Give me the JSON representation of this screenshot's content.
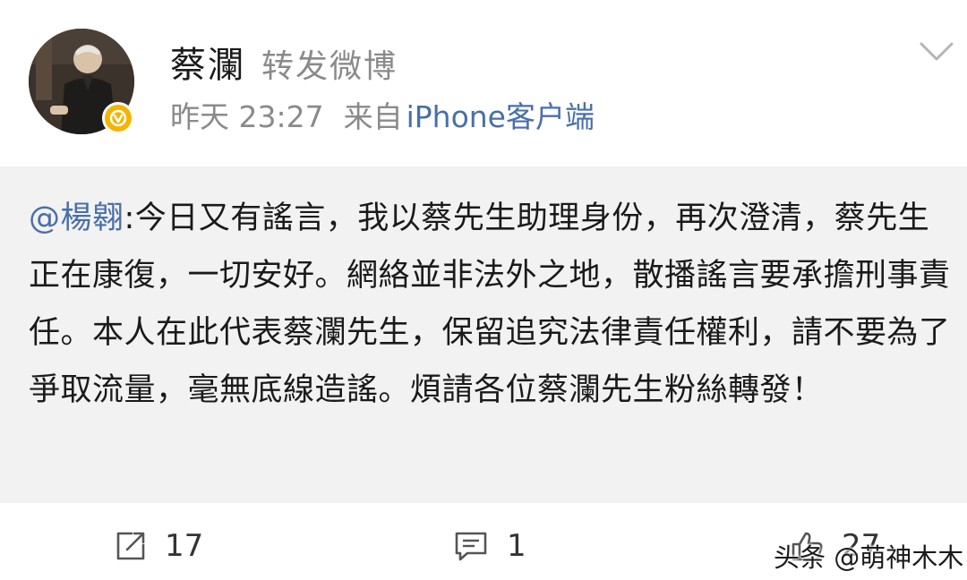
{
  "post": {
    "author": "蔡瀾",
    "action": "转发微博",
    "time": "昨天 23:27",
    "source_label": "来自",
    "source_client": "iPhone客户端",
    "verified": true
  },
  "repost": {
    "mention": "@楊翱",
    "text": ":今日又有謠言，我以蔡先生助理身份，再次澄清，蔡先生正在康復，一切安好。網絡並非法外之地，散播謠言要承擔刑事責任。本人在此代表蔡瀾先生，保留追究法律責任權利，請不要為了爭取流量，毫無底線造謠。煩請各位蔡瀾先生粉絲轉發！"
  },
  "actions": {
    "repost_count": "17",
    "comment_count": "1",
    "like_count": "27"
  },
  "watermark": "头条 @萌神木木",
  "colors": {
    "link": "#496fa8",
    "meta_gray": "#8a8a8a",
    "repost_bg": "#f2f2f2",
    "verified_badge": "#f4b400"
  },
  "icons": [
    "verified-badge-icon",
    "chevron-down-icon",
    "repost-icon",
    "comment-icon",
    "like-icon"
  ]
}
